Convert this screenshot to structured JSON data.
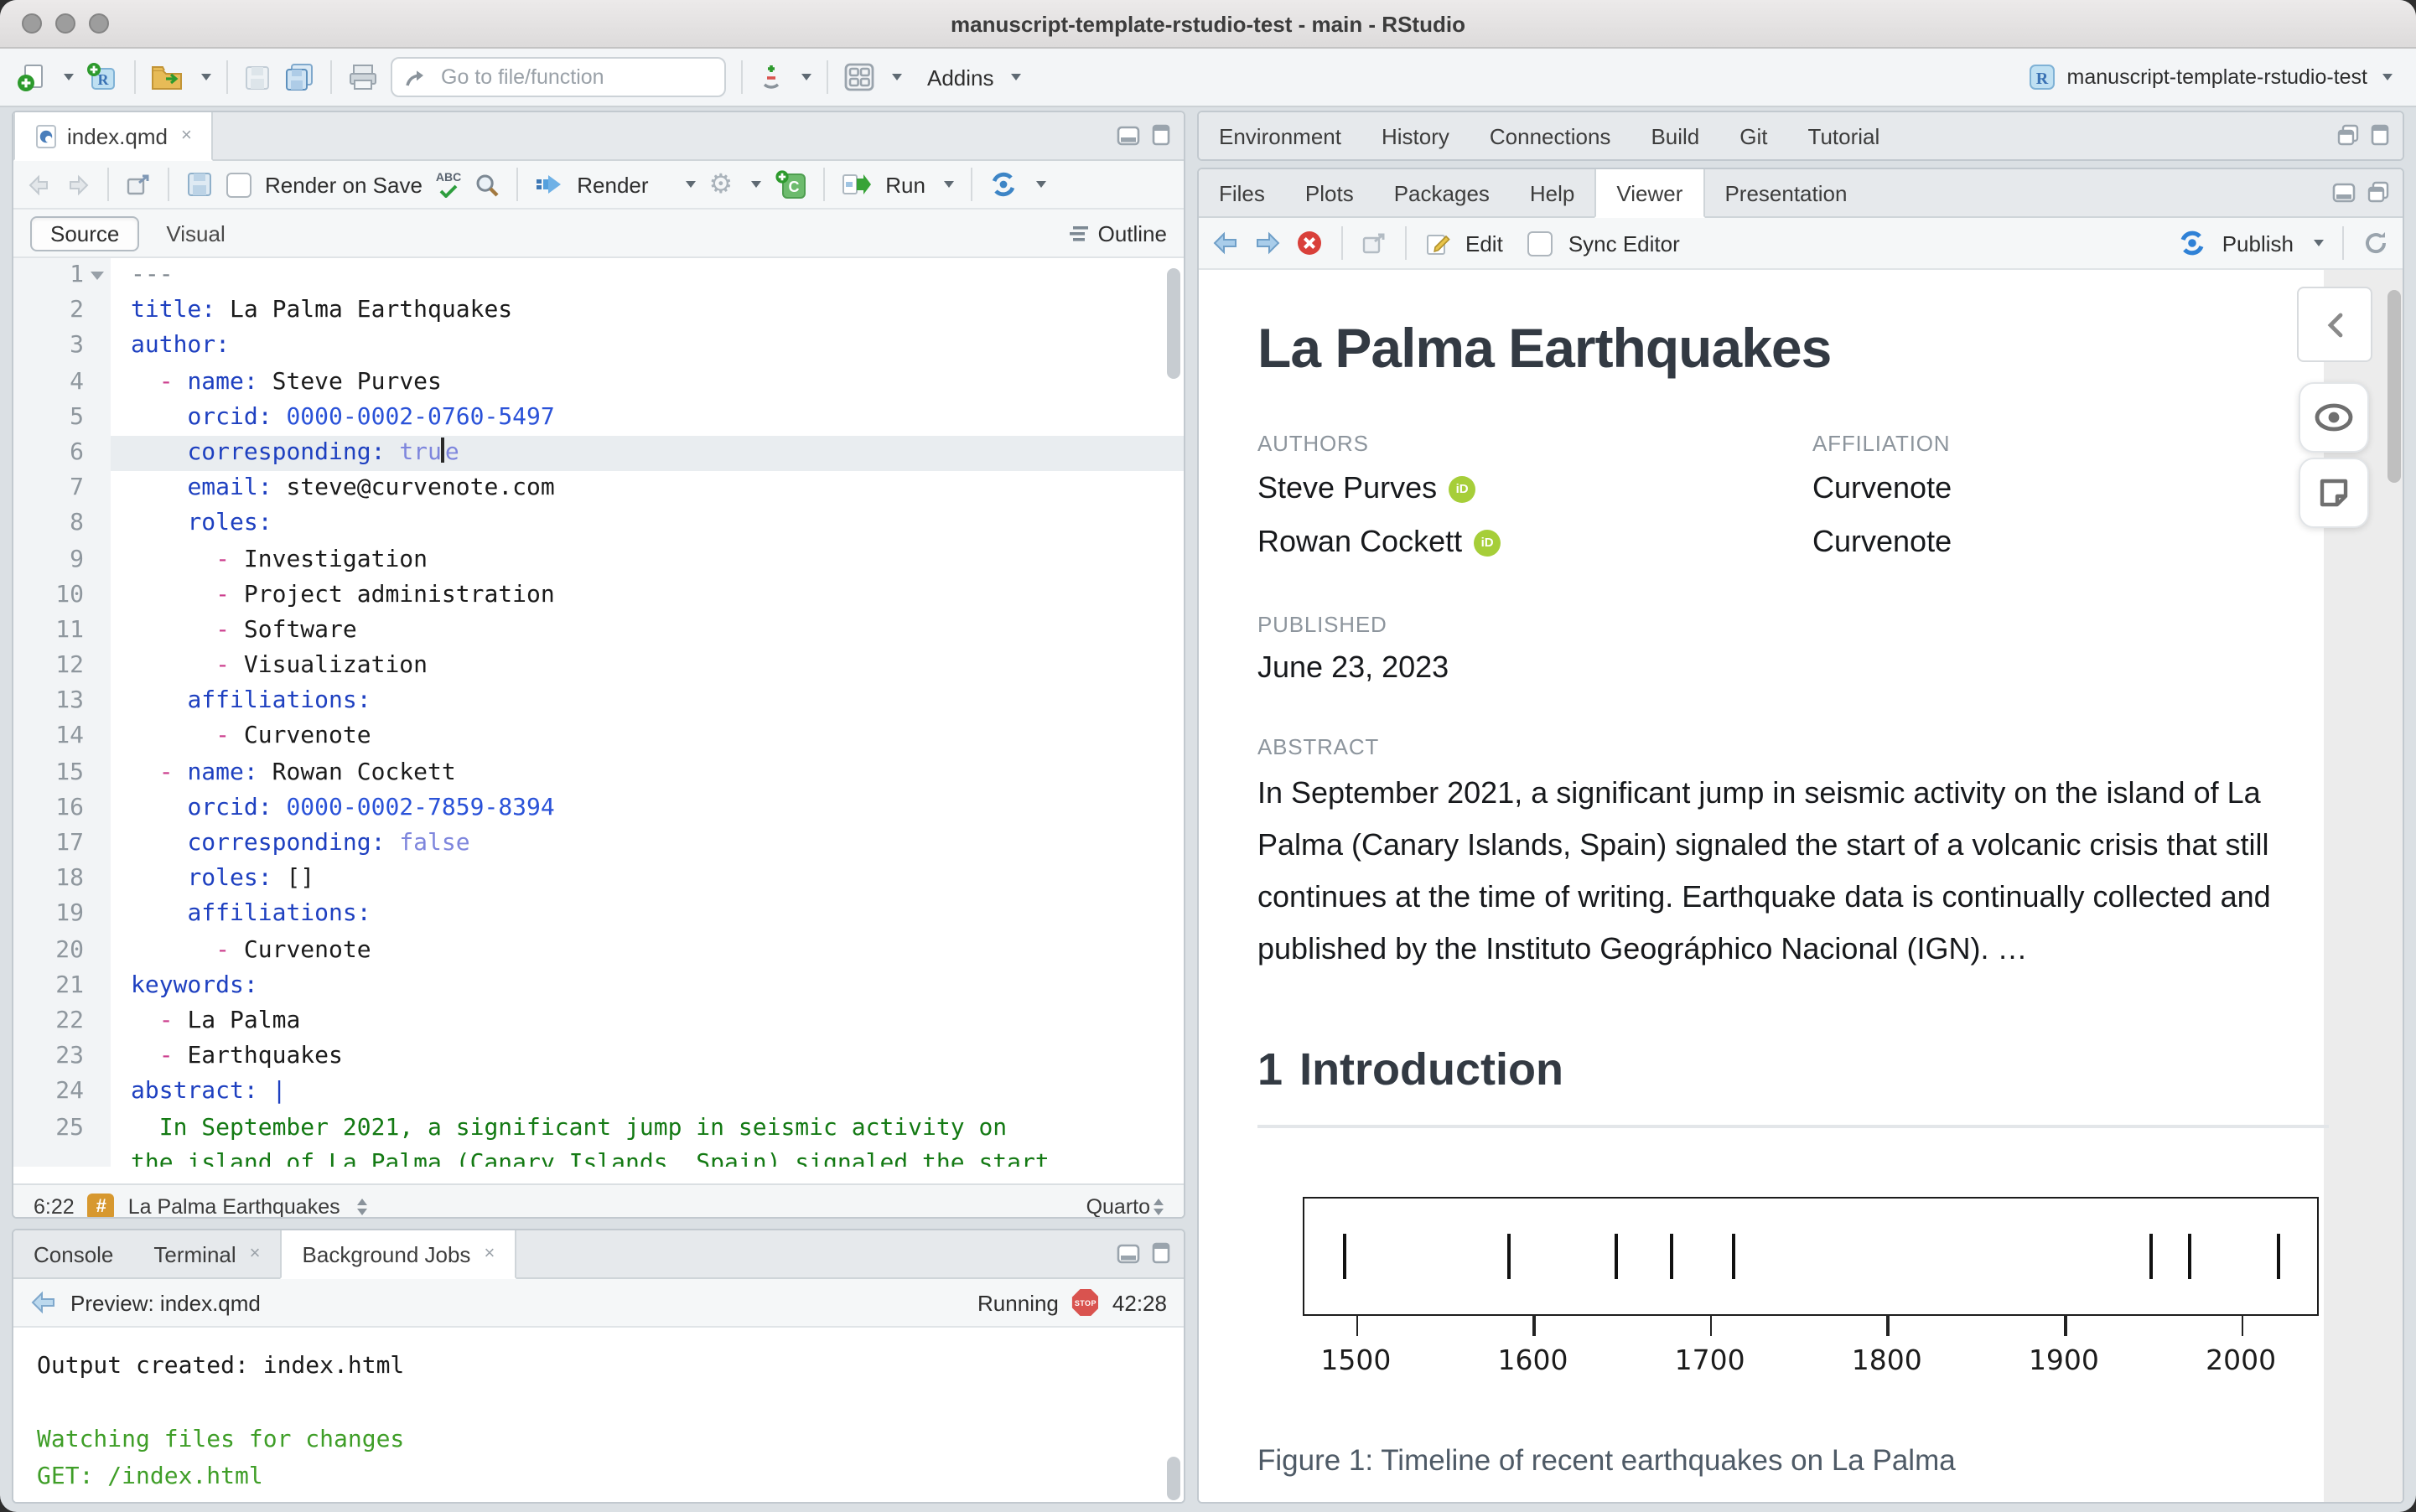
{
  "window": {
    "title": "manuscript-template-rstudio-test - main - RStudio",
    "project": "manuscript-template-rstudio-test",
    "project_icon_letter": "R"
  },
  "main_toolbar": {
    "goto_placeholder": "Go to file/function",
    "addins": "Addins",
    "spellcheck_glyph": "ABC"
  },
  "editor": {
    "tab": "index.qmd",
    "toolbar": {
      "render_on_save": "Render on Save",
      "render": "Render",
      "run": "Run",
      "chunk_letter": "C"
    },
    "mode_tabs": {
      "source": "Source",
      "visual": "Visual",
      "outline": "Outline"
    },
    "status": {
      "cursor": "6:22",
      "section_icon": "#",
      "section": "La Palma Earthquakes",
      "format": "Quarto"
    },
    "lines": [
      {
        "n": "1",
        "fold": true,
        "toks": [
          [
            "c",
            "---"
          ]
        ]
      },
      {
        "n": "2",
        "toks": [
          [
            "k",
            "title:"
          ],
          [
            "t",
            " La Palma Earthquakes"
          ]
        ]
      },
      {
        "n": "3",
        "toks": [
          [
            "k",
            "author:"
          ]
        ]
      },
      {
        "n": "4",
        "toks": [
          [
            "t",
            "  "
          ],
          [
            "d",
            "- "
          ],
          [
            "k",
            "name:"
          ],
          [
            "t",
            " Steve Purves"
          ]
        ]
      },
      {
        "n": "5",
        "toks": [
          [
            "t",
            "    "
          ],
          [
            "k",
            "orcid:"
          ],
          [
            "n",
            " 0000-0002-0760-5497"
          ]
        ]
      },
      {
        "n": "6",
        "hl": true,
        "toks": [
          [
            "t",
            "    "
          ],
          [
            "k",
            "corresponding:"
          ],
          [
            "b",
            " tru"
          ],
          [
            "caret",
            ""
          ],
          [
            "b",
            "e"
          ]
        ]
      },
      {
        "n": "7",
        "toks": [
          [
            "t",
            "    "
          ],
          [
            "k",
            "email:"
          ],
          [
            "t",
            " steve@curvenote.com"
          ]
        ]
      },
      {
        "n": "8",
        "toks": [
          [
            "t",
            "    "
          ],
          [
            "k",
            "roles:"
          ]
        ]
      },
      {
        "n": "9",
        "toks": [
          [
            "t",
            "      "
          ],
          [
            "d",
            "- "
          ],
          [
            "t",
            "Investigation"
          ]
        ]
      },
      {
        "n": "10",
        "toks": [
          [
            "t",
            "      "
          ],
          [
            "d",
            "- "
          ],
          [
            "t",
            "Project administration"
          ]
        ]
      },
      {
        "n": "11",
        "toks": [
          [
            "t",
            "      "
          ],
          [
            "d",
            "- "
          ],
          [
            "t",
            "Software"
          ]
        ]
      },
      {
        "n": "12",
        "toks": [
          [
            "t",
            "      "
          ],
          [
            "d",
            "- "
          ],
          [
            "t",
            "Visualization"
          ]
        ]
      },
      {
        "n": "13",
        "toks": [
          [
            "t",
            "    "
          ],
          [
            "k",
            "affiliations:"
          ]
        ]
      },
      {
        "n": "14",
        "toks": [
          [
            "t",
            "      "
          ],
          [
            "d",
            "- "
          ],
          [
            "t",
            "Curvenote"
          ]
        ]
      },
      {
        "n": "15",
        "toks": [
          [
            "t",
            "  "
          ],
          [
            "d",
            "- "
          ],
          [
            "k",
            "name:"
          ],
          [
            "t",
            " Rowan Cockett"
          ]
        ]
      },
      {
        "n": "16",
        "toks": [
          [
            "t",
            "    "
          ],
          [
            "k",
            "orcid:"
          ],
          [
            "n",
            " 0000-0002-7859-8394"
          ]
        ]
      },
      {
        "n": "17",
        "toks": [
          [
            "t",
            "    "
          ],
          [
            "k",
            "corresponding:"
          ],
          [
            "b",
            " false"
          ]
        ]
      },
      {
        "n": "18",
        "toks": [
          [
            "t",
            "    "
          ],
          [
            "k",
            "roles:"
          ],
          [
            "t",
            " []"
          ]
        ]
      },
      {
        "n": "19",
        "toks": [
          [
            "t",
            "    "
          ],
          [
            "k",
            "affiliations:"
          ]
        ]
      },
      {
        "n": "20",
        "toks": [
          [
            "t",
            "      "
          ],
          [
            "d",
            "- "
          ],
          [
            "t",
            "Curvenote"
          ]
        ]
      },
      {
        "n": "21",
        "toks": [
          [
            "k",
            "keywords:"
          ]
        ]
      },
      {
        "n": "22",
        "toks": [
          [
            "t",
            "  "
          ],
          [
            "d",
            "- "
          ],
          [
            "t",
            "La Palma"
          ]
        ]
      },
      {
        "n": "23",
        "toks": [
          [
            "t",
            "  "
          ],
          [
            "d",
            "- "
          ],
          [
            "t",
            "Earthquakes"
          ]
        ]
      },
      {
        "n": "24",
        "toks": [
          [
            "k",
            "abstract:"
          ],
          [
            "k",
            " |"
          ]
        ]
      },
      {
        "n": "25",
        "toks": [
          [
            "t",
            "  "
          ],
          [
            "g",
            "In September 2021, a significant jump in seismic activity on"
          ]
        ]
      },
      {
        "n": "",
        "clip": true,
        "toks": [
          [
            "g",
            "the island of La Palma (Canary Islands, Spain) signaled the start"
          ]
        ]
      }
    ]
  },
  "console_pane": {
    "tabs": [
      {
        "label": "Console",
        "closable": false,
        "active": false
      },
      {
        "label": "Terminal",
        "closable": true,
        "active": false
      },
      {
        "label": "Background Jobs",
        "closable": true,
        "active": true
      }
    ],
    "toolbar": {
      "preview": "Preview: index.qmd",
      "status": "Running",
      "stop_label": "STOP",
      "elapsed": "42:28"
    },
    "lines": [
      {
        "text": "Output created: index.html",
        "color": "plain"
      },
      {
        "text": "",
        "color": "plain"
      },
      {
        "text": "Watching files for changes",
        "color": "green"
      },
      {
        "text": "GET: /index.html",
        "color": "green"
      }
    ]
  },
  "env_pane": {
    "tabs": [
      {
        "label": "Environment"
      },
      {
        "label": "History"
      },
      {
        "label": "Connections"
      },
      {
        "label": "Build"
      },
      {
        "label": "Git"
      },
      {
        "label": "Tutorial"
      }
    ]
  },
  "viewer_pane": {
    "tabs": [
      {
        "label": "Files"
      },
      {
        "label": "Plots"
      },
      {
        "label": "Packages"
      },
      {
        "label": "Help"
      },
      {
        "label": "Viewer",
        "active": true
      },
      {
        "label": "Presentation"
      }
    ],
    "toolbar": {
      "edit": "Edit",
      "sync": "Sync Editor",
      "publish": "Publish"
    },
    "article": {
      "title": "La Palma Earthquakes",
      "authors_label": "AUTHORS",
      "affiliation_label": "AFFILIATION",
      "authors": [
        {
          "name": "Steve Purves",
          "affiliation": "Curvenote"
        },
        {
          "name": "Rowan Cockett",
          "affiliation": "Curvenote"
        }
      ],
      "orcid_glyph": "iD",
      "published_label": "PUBLISHED",
      "published": "June 23, 2023",
      "abstract_label": "ABSTRACT",
      "abstract": "In September 2021, a significant jump in seismic activity on the island of La Palma (Canary Islands, Spain) signaled the start of a volcanic crisis that still continues at the time of writing. Earthquake data is continually collected and published by the Instituto Geográphico Nacional (IGN). …",
      "section_number": "1",
      "section_title": "Introduction",
      "figure_caption": "Figure 1: Timeline of recent earthquakes on La Palma"
    }
  },
  "chart_data": {
    "type": "scatter",
    "subtype": "rug-timeline",
    "title": "Timeline of recent earthquakes on La Palma",
    "x": [
      1492,
      1585,
      1646,
      1677,
      1712,
      1949,
      1971,
      2021
    ],
    "xticks": [
      1500,
      1600,
      1700,
      1800,
      1900,
      2000
    ],
    "xlim": [
      1470,
      2044
    ],
    "xlabel": "",
    "ylabel": "",
    "grid": false,
    "legend": false
  }
}
